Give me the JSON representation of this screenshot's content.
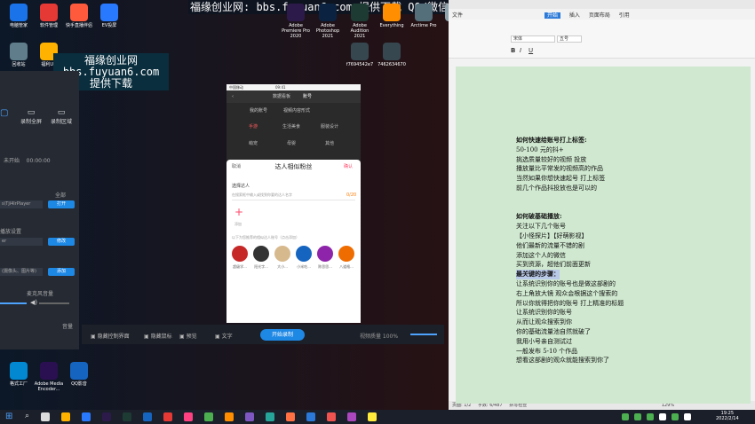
{
  "watermark": {
    "top": "福缘创业网: bbs.fuyuan6.com  提供下载  QQ/微信: 86051064",
    "box_lines": [
      "福缘创业网",
      "bbs.fuyuan6.com",
      "提供下载"
    ]
  },
  "desktop_icons": [
    {
      "label": "电脑管家",
      "color": "#1a73e8"
    },
    {
      "label": "软件管理",
      "color": "#e53935"
    },
    {
      "label": "快手直播伴侣",
      "color": "#ff5a3c"
    },
    {
      "label": "EV投屏",
      "color": "#2979ff"
    },
    {
      "label": "回收站",
      "color": "#607d8b"
    },
    {
      "label": "福利UR",
      "color": "#ffb300"
    },
    {
      "label": "Adobe Premiere Pro 2020",
      "color": "#2c1a4a"
    },
    {
      "label": "Adobe Photoshop 2021",
      "color": "#0b2340"
    },
    {
      "label": "Adobe Audition 2021",
      "color": "#1d3b33"
    },
    {
      "label": "Everything",
      "color": "#ff8f00"
    },
    {
      "label": "Arctime Pro",
      "color": "#546e7a"
    },
    {
      "label": "V",
      "color": "#90a4ae"
    },
    {
      "label": "f7694542e7",
      "color": "#37474f"
    },
    {
      "label": "7462634670",
      "color": "#37474f"
    },
    {
      "label": "格式工厂",
      "color": "#0288d1"
    },
    {
      "label": "Adobe Media Encoder...",
      "color": "#2a1050"
    },
    {
      "label": "QQ影音",
      "color": "#1565c0"
    }
  ],
  "rec_panel": {
    "tabs": [
      "录制全屏",
      "录制区域"
    ],
    "timer": "00:00:00",
    "timer_prefix": "未开始",
    "row_label": "全部",
    "player": "s\\Tjl4lrPlayer",
    "open_button": "打开",
    "section1": "播放设置",
    "modify_button": "修改",
    "placeholder": "(摄像头、图片等)",
    "add_button": "添加",
    "volume_label": "麦克风音量",
    "bottom_label": "音量"
  },
  "phone": {
    "status_left": "中国移动",
    "status_time": "09:41",
    "tab_left": "数据看板",
    "tab_right": "账号",
    "filter_left": "我的账号",
    "filter_right": "视频内容形式",
    "tags": [
      "手游",
      "生活美食",
      "服装设计",
      "萌宠",
      "母婴",
      "其他"
    ]
  },
  "sheet": {
    "cancel": "取消",
    "title": "达人相似粉丝",
    "confirm": "确认",
    "section": "选择达人",
    "hint": "在搜索框中输入或找到你要的达人名字",
    "count": "0/20",
    "add": "添加",
    "recommend": "以下为您推荐的相似达人账号（点击添加）",
    "avatars": [
      "超级学...",
      "阳光字...",
      "大小...",
      "小米吃...",
      "陈思思...",
      "八道格..."
    ]
  },
  "rec_bar": {
    "items": [
      "隐藏控制界面",
      "隐藏鼠标",
      "预览",
      "文字"
    ],
    "start": "开始录制",
    "quality": "视频质量 100%"
  },
  "doc": {
    "menu": [
      "文件",
      "开始",
      "插入",
      "页面布局",
      "引用"
    ],
    "font": "宋体",
    "size": "五号",
    "pagination": "页面: 1/2",
    "words": "字数: 6/487",
    "spell": "拼写检查",
    "zoom": "129%"
  },
  "doc_lines": [
    "如何快速给账号打上标签:",
    "50-100 元的抖+",
    "挑选质量较好的视频  投放",
    "播放量比平常发的视频高的作品",
    "当然如果你想快速起号  打上标签",
    "前几个作品抖投放也是可以的",
    "",
    "",
    "如何破基础播放:",
    "关注以下几个账号",
    "【小怪探片】【好萌影视】",
    "他们最新的流量不错的剧",
    "添加这个人的微信",
    "  买到资源，超他们前面更新",
    "最关键的步骤：",
    "让系统识别你的账号也是做这部剧的",
    "右上角放大镜  观众会根据这个搜索的",
    "所以你就得把你的账号  打上精准的标题",
    "让系统识别你的账号",
    "从而让观众搜索到你",
    "你的基础流量池自然就破了",
    "我用小号亲自测试过",
    "一般发布 5-10 个作品",
    "想看这部剧的观众就能搜索到你了"
  ],
  "taskbar": {
    "time": "19:25",
    "date": "2022/2/14"
  }
}
